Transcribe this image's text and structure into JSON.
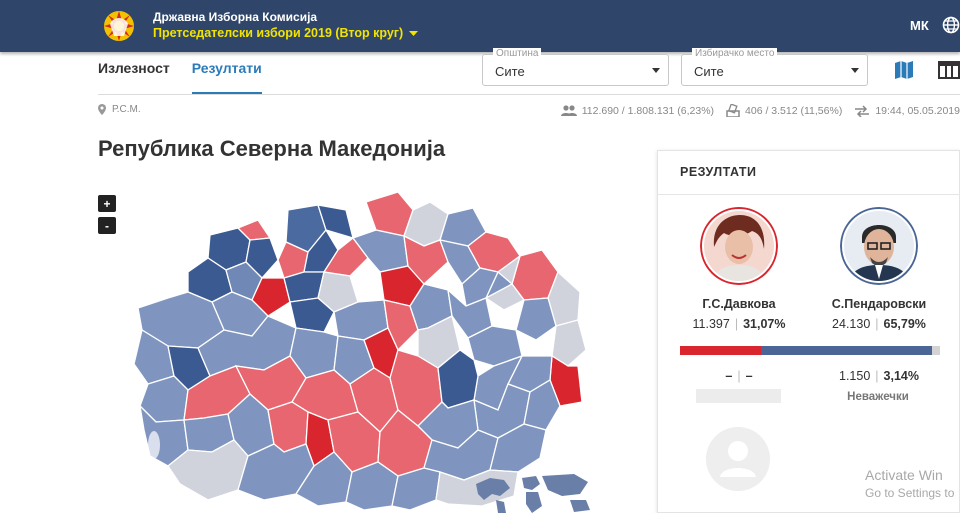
{
  "header": {
    "org_name": "Државна Изборна Комисија",
    "election_name": "Претседателски избори 2019 (Втор круг)",
    "language": "МК",
    "icons": {
      "logo": "flag-emblem-icon",
      "dropdown": "caret-down-icon",
      "globe": "globe-icon"
    }
  },
  "tabs": [
    {
      "label": "Излезност",
      "active": false
    },
    {
      "label": "Резултати",
      "active": true
    }
  ],
  "filters": {
    "municipality": {
      "label": "Општина",
      "value": "Сите"
    },
    "polling_station": {
      "label": "Избирачко место",
      "value": "Сите"
    }
  },
  "view_buttons": [
    {
      "icon": "map-icon",
      "active": true
    },
    {
      "icon": "table-icon",
      "active": false
    }
  ],
  "breadcrumb": {
    "icon": "location-pin-icon",
    "text": "Р.С.М."
  },
  "stats": [
    {
      "icon": "voters-icon",
      "text": "112.690 / 1.808.131 (6,23%)"
    },
    {
      "icon": "ballot-box-icon",
      "text": "406 / 3.512 (11,56%)"
    },
    {
      "icon": "sync-arrows-icon",
      "text": "19:44, 05.05.2019"
    }
  ],
  "page_title": "Република Северна Македонија",
  "zoom": {
    "in": "+",
    "out": "-"
  },
  "results": {
    "title": "РЕЗУЛТАТИ",
    "candidates": [
      {
        "name": "Г.С.Давкова",
        "votes": "11.397",
        "percent": "31,07%",
        "share": 31.07,
        "color": "#d9262e"
      },
      {
        "name": "С.Пендаровски",
        "votes": "24.130",
        "percent": "65,79%",
        "share": 65.79,
        "color": "#4b6696"
      }
    ],
    "rest_share": 3.14,
    "left_extra": {
      "votes": "–",
      "percent": "–"
    },
    "invalid": {
      "votes": "1.150",
      "percent": "3,14%",
      "label": "Неважечки"
    }
  },
  "watermark": {
    "title": "Activate Win",
    "subtitle": "Go to Settings to"
  },
  "colors": {
    "header": "#2f466a",
    "accent": "#2b7bb9",
    "yellow": "#f2e400",
    "red": "#d9262e",
    "blue": "#4b6696"
  }
}
